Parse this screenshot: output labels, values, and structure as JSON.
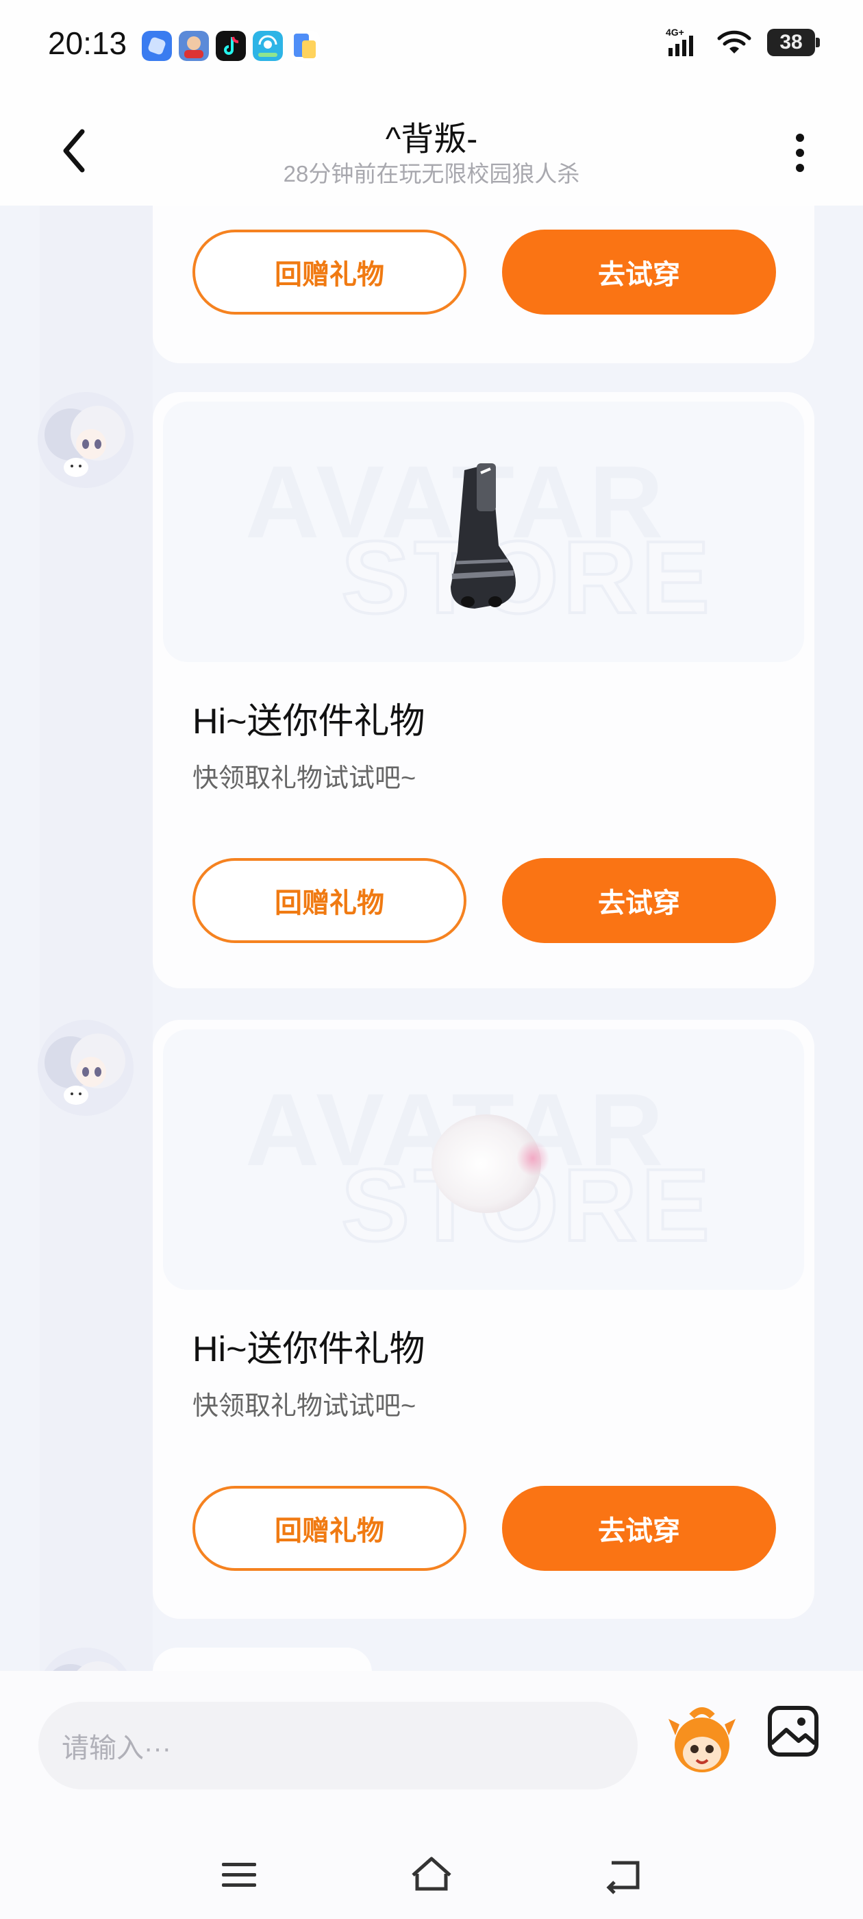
{
  "status_bar": {
    "time": "20:13",
    "network": "4G+",
    "battery": "38",
    "app_icons": [
      "blue-app-icon",
      "game-app-icon",
      "tiktok-icon",
      "wifi-app-icon",
      "doc-app-icon"
    ]
  },
  "header": {
    "title": "^背叛-",
    "subtitle": "28分钟前在玩无限校园狼人杀"
  },
  "messages": [
    {
      "partial": true,
      "return_gift_label": "回赠礼物",
      "try_on_label": "去试穿"
    },
    {
      "gift_item": "socks-icon",
      "watermark_top": "AVATAR",
      "watermark_bottom": "STORE",
      "title": "Hi~送你件礼物",
      "text": "快领取礼物试试吧~",
      "return_gift_label": "回赠礼物",
      "try_on_label": "去试穿"
    },
    {
      "gift_item": "blush-icon",
      "watermark_top": "AVATAR",
      "watermark_bottom": "STORE",
      "title": "Hi~送你件礼物",
      "text": "快领取礼物试试吧~",
      "return_gift_label": "回赠礼物",
      "try_on_label": "去试穿"
    }
  ],
  "input": {
    "placeholder": "请输入···"
  },
  "colors": {
    "accent": "#fa7414",
    "background": "#f2f4fa",
    "card": "#fdfdfe"
  }
}
